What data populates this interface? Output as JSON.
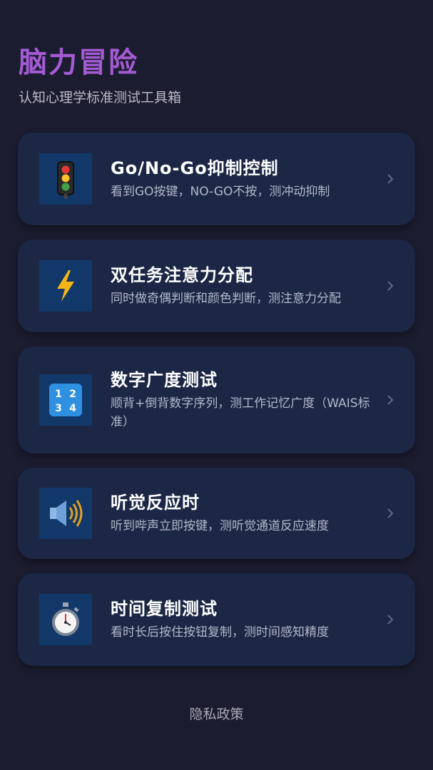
{
  "header": {
    "title": "脑力冒险",
    "subtitle": "认知心理学标准测试工具箱"
  },
  "tests": [
    {
      "icon": "traffic-light-icon",
      "title": "Go/No-Go抑制控制",
      "description": "看到GO按键，NO-GO不按，测冲动抑制"
    },
    {
      "icon": "lightning-icon",
      "title": "双任务注意力分配",
      "description": "同时做奇偶判断和颜色判断，测注意力分配"
    },
    {
      "icon": "number-keys-icon",
      "icon_digits": [
        "1",
        "2",
        "3",
        "4"
      ],
      "title": "数字广度测试",
      "description": "顺背+倒背数字序列，测工作记忆广度（WAIS标准）"
    },
    {
      "icon": "speaker-icon",
      "title": "听觉反应时",
      "description": "听到哔声立即按键，测听觉通道反应速度"
    },
    {
      "icon": "stopwatch-icon",
      "title": "时间复制测试",
      "description": "看时长后按住按钮复制，测时间感知精度"
    }
  ],
  "footer": {
    "privacy_label": "隐私政策"
  },
  "colors": {
    "background": "#1c1c30",
    "card": "#1b2745",
    "icon_tile": "#12386a",
    "title_accent": "#a35bd2"
  }
}
